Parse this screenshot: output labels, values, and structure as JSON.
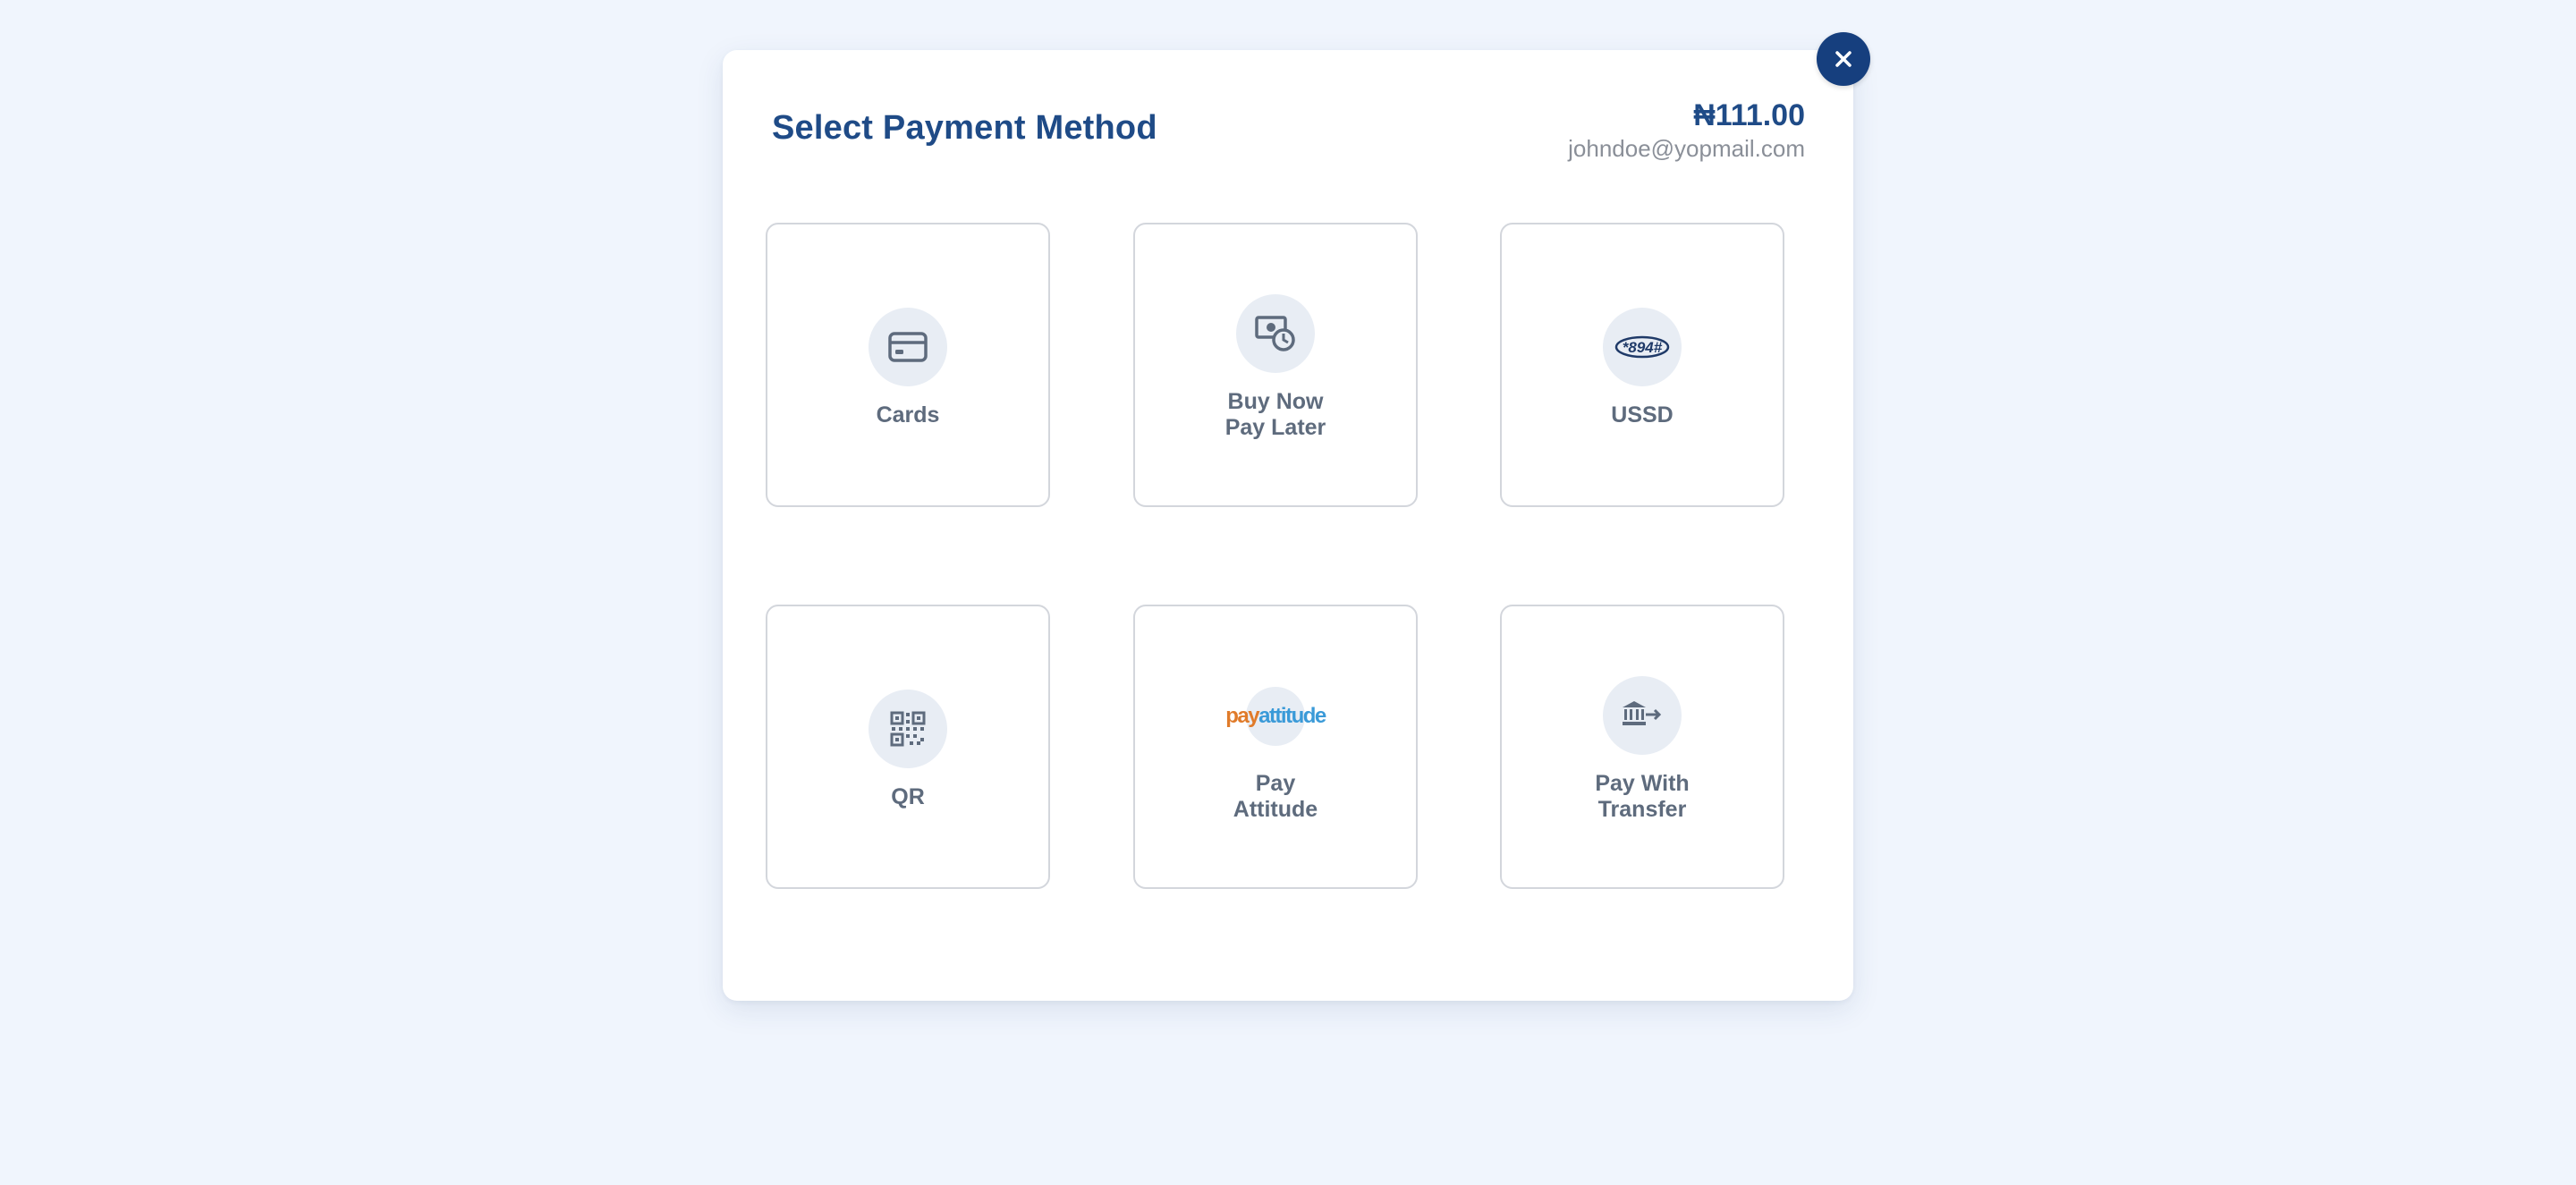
{
  "modal": {
    "title": "Select Payment Method",
    "amount": "₦111.00",
    "email": "johndoe@yopmail.com",
    "close_icon": "close-icon"
  },
  "methods": [
    {
      "label": "Cards",
      "icon": "credit-card-icon"
    },
    {
      "label": "Buy Now\nPay Later",
      "icon": "money-clock-icon"
    },
    {
      "label": "USSD",
      "icon": "ussd-code-icon",
      "icon_text": "*894#"
    },
    {
      "label": "QR",
      "icon": "qr-code-icon"
    },
    {
      "label": "Pay\nAttitude",
      "icon": "payattitude-logo",
      "logo_pay": "pay",
      "logo_attitude": "attitude"
    },
    {
      "label": "Pay With\nTransfer",
      "icon": "bank-transfer-icon"
    }
  ],
  "colors": {
    "page_background": "#f0f5fd",
    "brand_navy": "#1f4b87",
    "close_button": "#163f7e",
    "tile_border": "#d3d6dc",
    "icon_circle": "#e8edf4",
    "label_gray": "#5e6b7d",
    "payattitude_orange": "#e07b2a",
    "payattitude_blue": "#3a9ad8"
  }
}
